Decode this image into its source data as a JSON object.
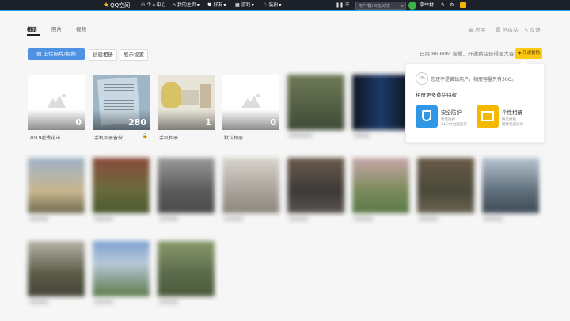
{
  "topbar": {
    "logo": "QQ空间",
    "items": [
      "个人中心",
      "我的主页",
      "好友",
      "游戏",
      "装扮"
    ],
    "search_placeholder": "用户/群/日志/动态",
    "username": "李**材"
  },
  "tabs": [
    "相册",
    "照片",
    "视频"
  ],
  "right_tools": [
    "应用",
    "回收站",
    "反馈"
  ],
  "toolbar": {
    "upload": "上传照片/视频",
    "create": "创建相册",
    "settings": "展示设置",
    "capacity": "已用 86.60M 容量，开通黄钻获得更大容量",
    "vip_button": "开通黄钻"
  },
  "albums": [
    {
      "label": "2019看秀花市",
      "count": "0"
    },
    {
      "label": "手机相册备份",
      "count": "280"
    },
    {
      "label": "手机相册",
      "count": "1"
    },
    {
      "label": "默认相册",
      "count": "0"
    }
  ],
  "popup": {
    "percent": "1%",
    "message": "您还不是黄钻用户，相册容量只有30G。",
    "heading": "相册更多黄钻特权",
    "features": [
      {
        "title": "安全防护",
        "desc1": "智能防护",
        "desc2": "24小时全面监控"
      },
      {
        "title": "个性相册",
        "desc1": "精选模板",
        "desc2": "精致相册展示"
      }
    ]
  },
  "colors": {
    "accent_blue": "#4e92e3",
    "vip_yellow": "#ffc814",
    "topbar": "#1d2129",
    "accent_line": "#19a8f0"
  }
}
